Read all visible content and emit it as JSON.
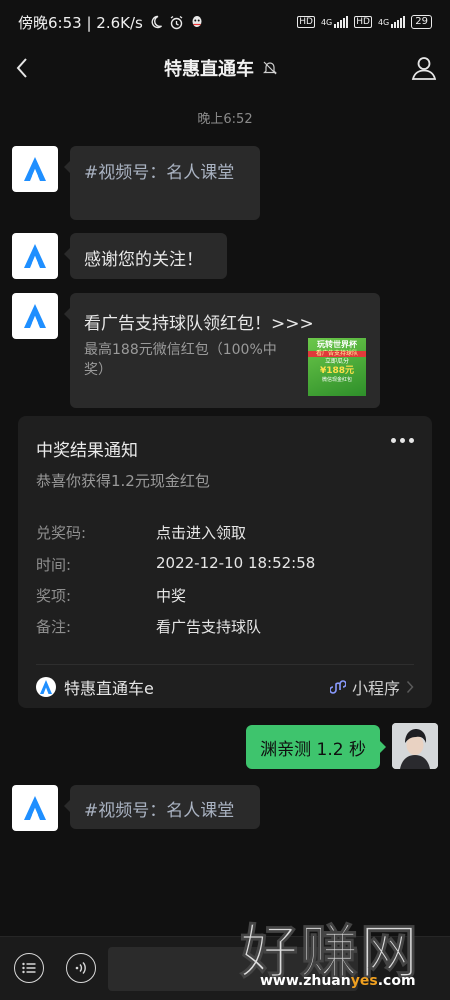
{
  "status_bar": {
    "left_text": "傍晚6:53 | 2.6K/s",
    "network_1": "4G",
    "network_2": "4G",
    "hd_1": "HD",
    "hd_2": "HD",
    "battery": "29"
  },
  "nav": {
    "title": "特惠直通车"
  },
  "timestamp": "晚上6:52",
  "messages": [
    {
      "text": "#视频号：名人课堂"
    },
    {
      "text": "感谢您的关注！"
    },
    {
      "title": "看广告支持球队领红包！>>>",
      "desc_line1": "最高188元微信红包（100%中",
      "desc_line2": "奖）",
      "thumb_line1": "玩转世界杯",
      "thumb_line2": "看广告支持球队",
      "thumb_line3": "立即瓜分",
      "thumb_line4": "¥188元",
      "thumb_line5": "微信现金红包"
    }
  ],
  "card": {
    "title": "中奖结果通知",
    "subtitle": "恭喜你获得1.2元现金红包",
    "rows": [
      {
        "key": "兑奖码:",
        "value": "点击进入领取"
      },
      {
        "key": "时间:",
        "value": "2022-12-10 18:52:58"
      },
      {
        "key": "奖项:",
        "value": "中奖"
      },
      {
        "key": "备注:",
        "value": "看广告支持球队"
      }
    ],
    "brand": "特惠直通车e",
    "mini_program": "小程序"
  },
  "my_message": "渊亲测 1.2 秒",
  "last_message": "#视频号：名人课堂",
  "watermark": {
    "big": "好赚网",
    "url_part1": "www.zhuan",
    "url_part2": "yes",
    "url_part3": ".com"
  },
  "colors": {
    "background": "#111111",
    "bubble": "#2a2a2a",
    "my_bubble": "#3ec46d",
    "brand_blue": "#1f8fff"
  }
}
